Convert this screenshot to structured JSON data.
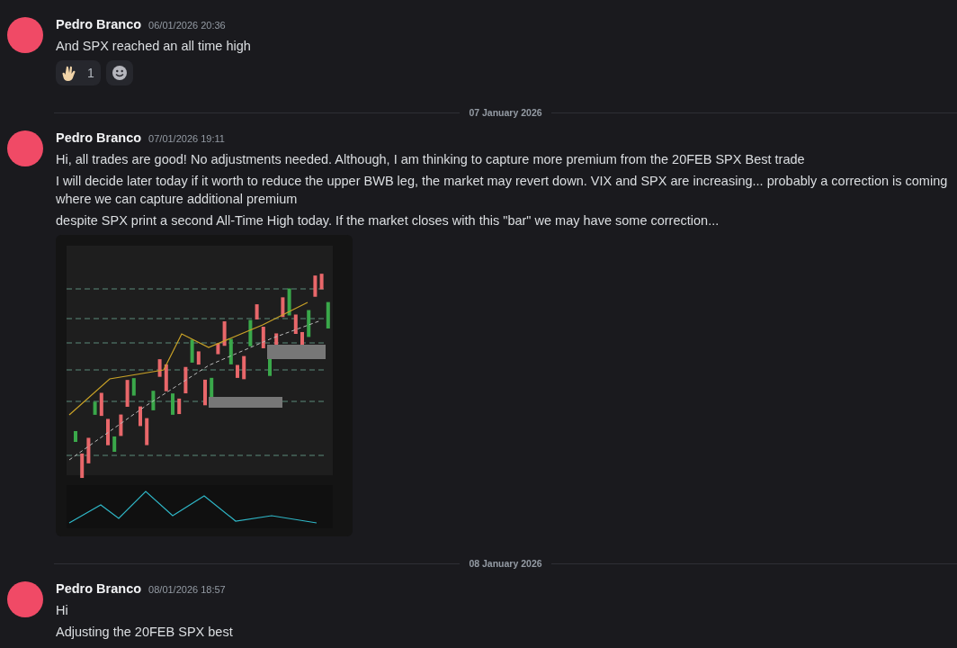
{
  "messages": [
    {
      "kind": "group",
      "author": "Pedro Branco",
      "timestamp": "06/01/2026 20:36",
      "lines": [
        "And SPX reached an all time high"
      ],
      "reactions": [
        {
          "kind": "emoji",
          "count": "1"
        },
        {
          "kind": "add"
        }
      ]
    },
    {
      "kind": "divider",
      "label": "07 January 2026"
    },
    {
      "kind": "group",
      "author": "Pedro Branco",
      "timestamp": "07/01/2026 19:11",
      "lines": [
        "Hi, all trades are good! No adjustments needed. Although, I am thinking to capture more premium from the 20FEB SPX Best trade",
        "I will decide later today if it worth to reduce the upper BWB leg, the market may revert down. VIX and SPX are increasing... probably a correction is coming where we can capture additional premium",
        "despite SPX print a second All-Time High today. If the market closes with this \"bar\" we may have some correction..."
      ]
    },
    {
      "kind": "divider",
      "label": "08 January 2026"
    },
    {
      "kind": "group",
      "author": "Pedro Branco",
      "timestamp": "08/01/2026 18:57",
      "lines": [
        "Hi",
        "Adjusting the 20FEB SPX best"
      ]
    }
  ]
}
